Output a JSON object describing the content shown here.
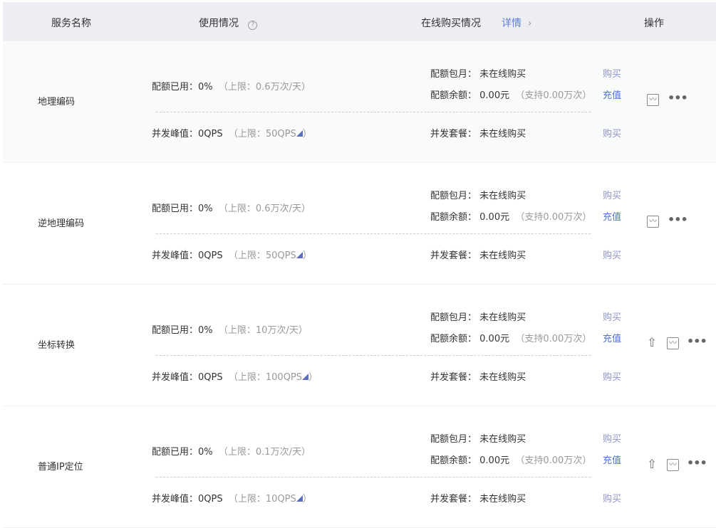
{
  "header": {
    "service_name": "服务名称",
    "usage": "使用情况",
    "help_icon": "?",
    "purchase": "在线购买情况",
    "details_link": "详情",
    "details_chevron": "›",
    "actions": "操作"
  },
  "labels": {
    "quota_used": "配额已用：",
    "peak": "并发峰值：",
    "monthly": "配额包月：",
    "balance": "配额余额：",
    "package": "并发套餐：",
    "buy": "购买",
    "recharge": "充值",
    "not_bought": "未在线购买",
    "more": "•••",
    "chart_icon": "〰",
    "upload_icon": "⇧"
  },
  "rows": [
    {
      "name": "地理编码",
      "quota": "0%",
      "quota_limit": "（上限：0.6万次/天）",
      "peak": "0QPS",
      "peak_limit": "（上限：50QPS",
      "peak_limit_end": "）",
      "balance": "0.00元",
      "balance_note": "（支持0.00万次）",
      "upload": false
    },
    {
      "name": "逆地理编码",
      "quota": "0%",
      "quota_limit": "（上限：0.6万次/天）",
      "peak": "0QPS",
      "peak_limit": "（上限：50QPS",
      "peak_limit_end": "）",
      "balance": "0.00元",
      "balance_note": "（支持0.00万次）",
      "upload": false
    },
    {
      "name": "坐标转换",
      "quota": "0%",
      "quota_limit": "（上限：10万次/天）",
      "peak": "0QPS",
      "peak_limit": "（上限：100QPS",
      "peak_limit_end": "）",
      "balance": "0.00元",
      "balance_note": "（支持0.00万次）",
      "upload": true
    },
    {
      "name": "普通IP定位",
      "quota": "0%",
      "quota_limit": "（上限：0.1万次/天）",
      "peak": "0QPS",
      "peak_limit": "（上限：10QPS",
      "peak_limit_end": "）",
      "balance": "0.00元",
      "balance_note": "（支持0.00万次）",
      "upload": true
    }
  ]
}
